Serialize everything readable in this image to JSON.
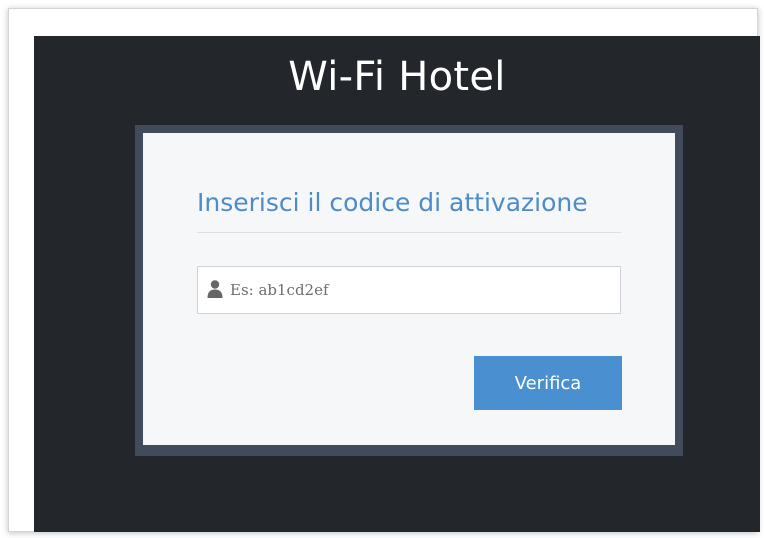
{
  "app": {
    "title": "Wi-Fi Hotel"
  },
  "activation_form": {
    "heading": "Inserisci il codice di attivazione",
    "code_input": {
      "value": "",
      "placeholder": "Es: ab1cd2ef",
      "icon": "user-icon"
    },
    "verify_label": "Verifica"
  },
  "colors": {
    "background": "#23272b",
    "panel_border": "#414b5c",
    "panel": "#f6f7f8",
    "accent": "#4a8fcf",
    "heading": "#4d8cc8"
  }
}
